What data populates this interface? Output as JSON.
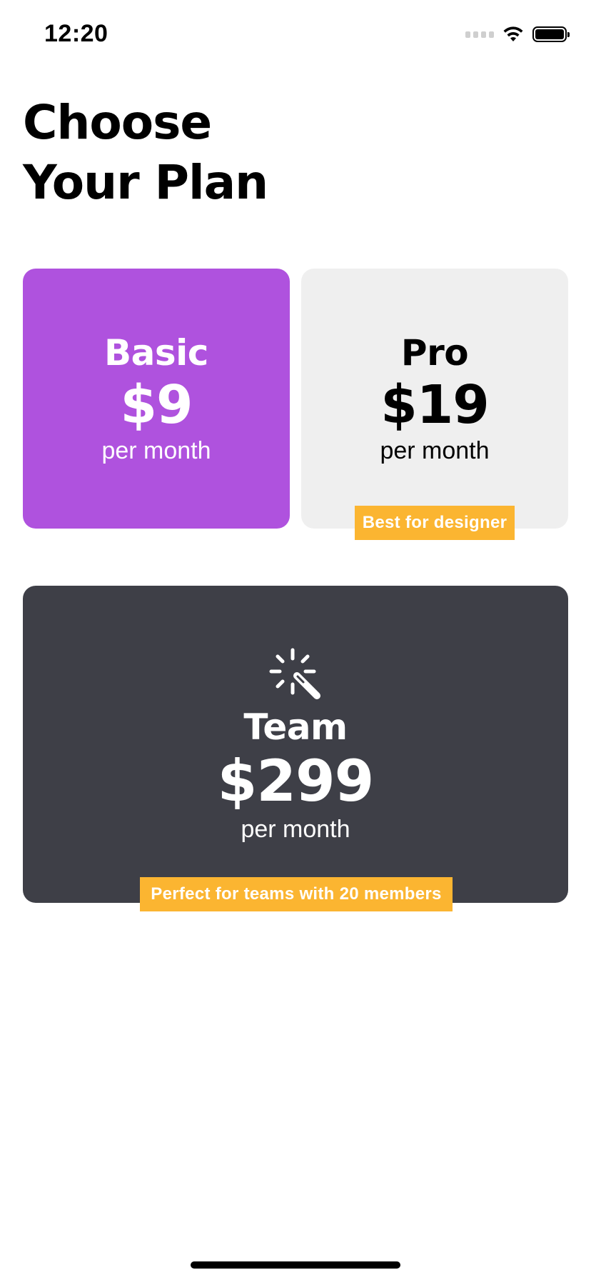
{
  "status_bar": {
    "time": "12:20"
  },
  "header": {
    "title_line1": "Choose",
    "title_line2": "Your Plan"
  },
  "plans": [
    {
      "name": "Basic",
      "price": "$9",
      "period": "per month",
      "background": "#af52de",
      "text_color": "#ffffff"
    },
    {
      "name": "Pro",
      "price": "$19",
      "period": "per month",
      "badge": "Best for designer",
      "background": "#efefef",
      "text_color": "#000000"
    },
    {
      "name": "Team",
      "price": "$299",
      "period": "per month",
      "badge": "Perfect for teams with 20 members",
      "icon": "magic-wand-icon",
      "background": "#3e3f47",
      "text_color": "#ffffff"
    }
  ],
  "colors": {
    "badge": "#fbb531",
    "accent_basic": "#af52de"
  }
}
